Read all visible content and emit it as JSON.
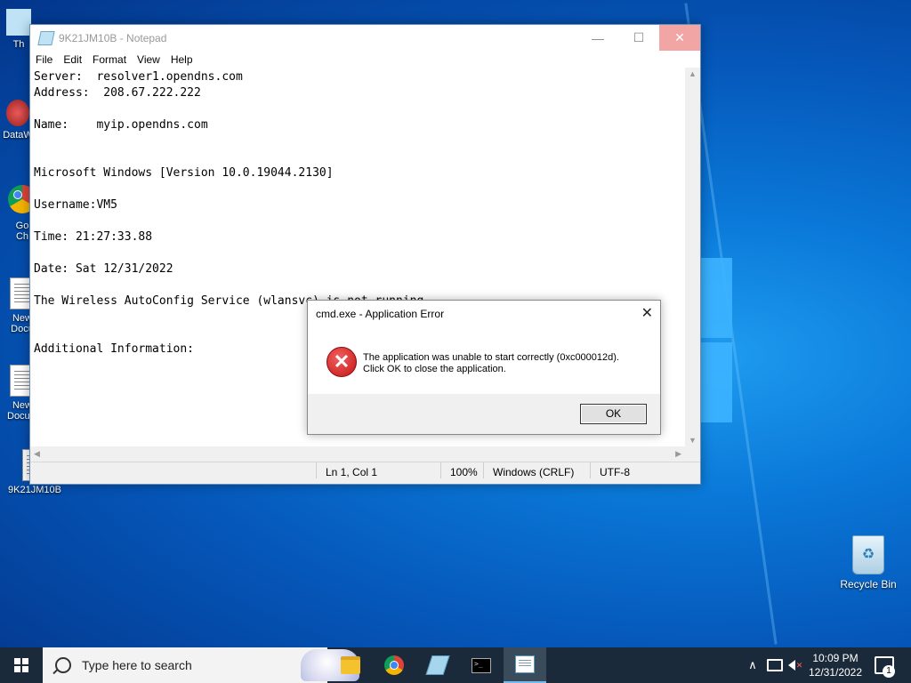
{
  "desktop": {
    "icons": [
      {
        "label": "Th"
      },
      {
        "label": "DataW"
      },
      {
        "label": "Go Ch"
      },
      {
        "label": "New Docu"
      },
      {
        "label": "New Docum"
      },
      {
        "label": "9K21JM10B"
      }
    ],
    "recycle_bin": {
      "label": "Recycle Bin"
    }
  },
  "notepad": {
    "title": "9K21JM10B - Notepad",
    "menu": [
      "File",
      "Edit",
      "Format",
      "View",
      "Help"
    ],
    "content": "Server:  resolver1.opendns.com\nAddress:  208.67.222.222\n\nName:    myip.opendns.com\n\n\nMicrosoft Windows [Version 10.0.19044.2130]\n\nUsername:VM5\n\nTime: 21:27:33.88\n\nDate: Sat 12/31/2022\n\nThe Wireless AutoConfig Service (wlansvc) is not running.\n\n\nAdditional Information:",
    "status": {
      "position": "Ln 1, Col 1",
      "zoom": "100%",
      "line_ending": "Windows (CRLF)",
      "encoding": "UTF-8"
    }
  },
  "error_dialog": {
    "title": "cmd.exe - Application Error",
    "message_line1": "The application was unable to start correctly (0xc000012d).",
    "message_line2": "Click OK to close the application.",
    "ok_label": "OK"
  },
  "taskbar": {
    "search_placeholder": "Type here to search",
    "time": "10:09 PM",
    "date": "12/31/2022",
    "notification_count": "1",
    "tray_chevron": "∧"
  },
  "icons": {
    "minimize": "—",
    "maximize": "☐",
    "close": "✕",
    "error": "✕"
  }
}
